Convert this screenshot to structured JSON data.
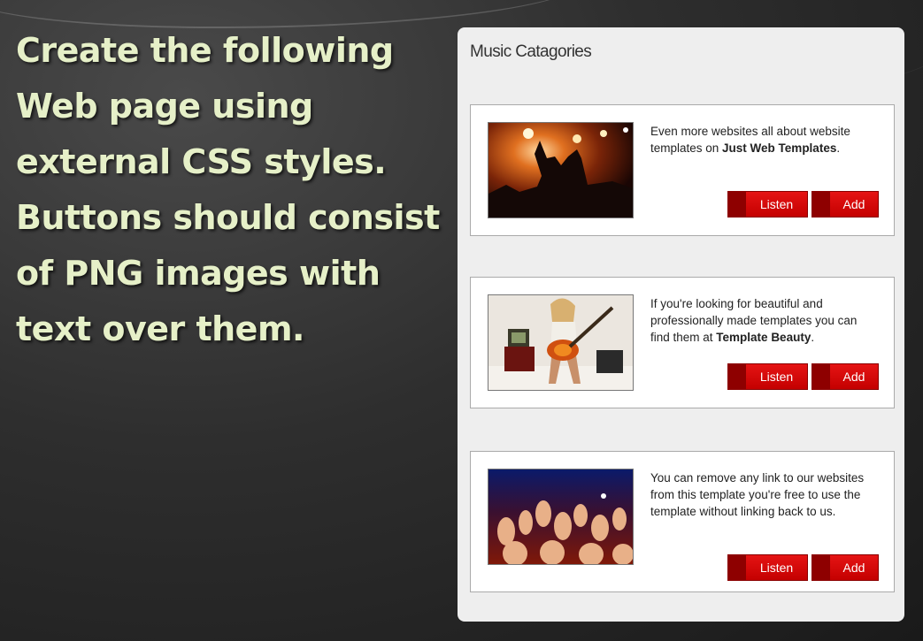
{
  "slide": {
    "lines": [
      "Create the following",
      "Web page using",
      "external CSS styles.",
      "Buttons should consist",
      "of PNG images with",
      "text over them."
    ]
  },
  "panel": {
    "title": "Music Catagories",
    "cards": [
      {
        "image": "concert-silhouette-photo",
        "text_before": "Even more websites all about website templates on ",
        "text_bold": "Just Web Templates",
        "text_after": ".",
        "listen_label": "Listen",
        "add_label": "Add"
      },
      {
        "image": "guitarist-photo",
        "text_before": "If you're looking for beautiful and professionally made templates you can find them at ",
        "text_bold": "Template Beauty",
        "text_after": ".",
        "listen_label": "Listen",
        "add_label": "Add"
      },
      {
        "image": "crowd-hands-photo",
        "text_before": "You can remove any link to our websites from this template you're free to use the template without linking back to us.",
        "text_bold": "",
        "text_after": "",
        "listen_label": "Listen",
        "add_label": "Add"
      }
    ]
  },
  "colors": {
    "slide_text": "#e6f0c8",
    "button_red": "#d40a0a",
    "button_tab": "#8e0000"
  }
}
